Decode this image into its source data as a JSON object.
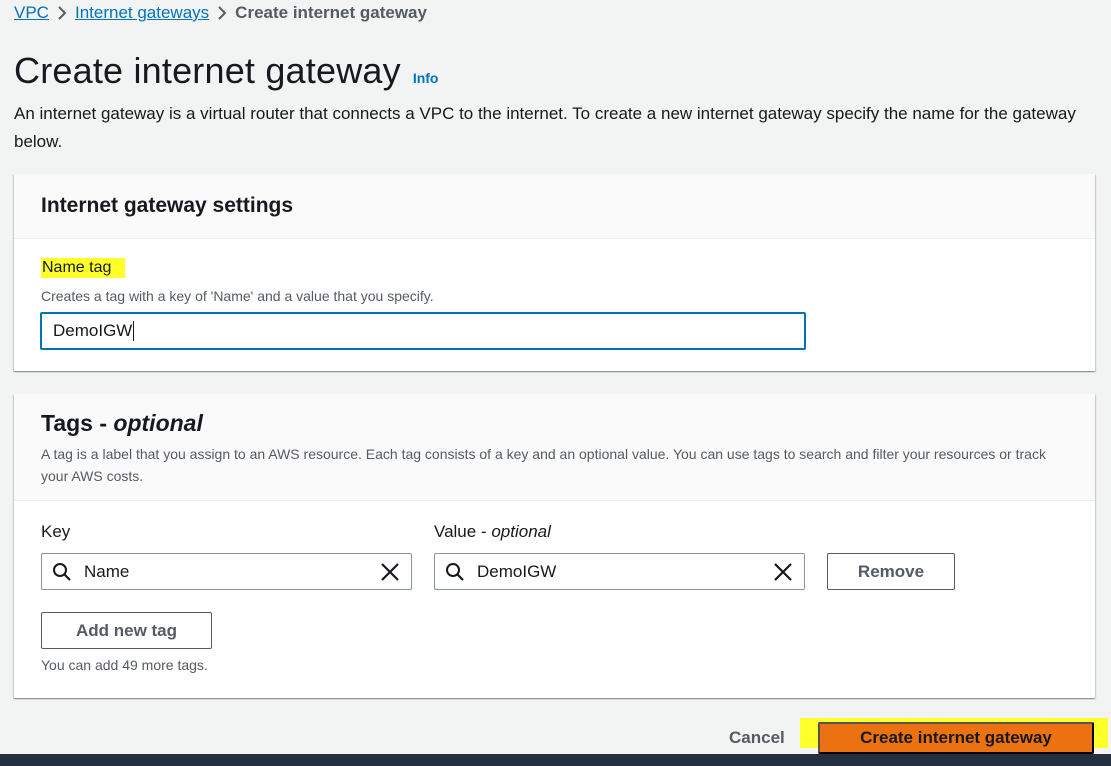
{
  "breadcrumb": {
    "items": [
      "VPC",
      "Internet gateways"
    ],
    "current": "Create internet gateway"
  },
  "header": {
    "title": "Create internet gateway",
    "info": "Info",
    "description": "An internet gateway is a virtual router that connects a VPC to the internet. To create a new internet gateway specify the name for the gateway below."
  },
  "settings": {
    "title": "Internet gateway settings",
    "name_label": "Name tag",
    "name_hint": "Creates a tag with a key of 'Name' and a value that you specify.",
    "name_value": "DemoIGW"
  },
  "tags": {
    "title_prefix": "Tags - ",
    "title_optional": "optional",
    "description": "A tag is a label that you assign to an AWS resource. Each tag consists of a key and an optional value. You can use tags to search and filter your resources or track your AWS costs.",
    "key_label": "Key",
    "value_label_prefix": "Value - ",
    "value_label_optional": "optional",
    "rows": [
      {
        "key": "Name",
        "value": "DemoIGW"
      }
    ],
    "remove_label": "Remove",
    "add_label": "Add new tag",
    "remaining_text": "You can add 49 more tags."
  },
  "footer": {
    "cancel_label": "Cancel",
    "create_label": "Create internet gateway"
  },
  "colors": {
    "link": "#0073bb",
    "primary_button": "#ec7211",
    "highlight": "#ffff2a",
    "bottom_bar": "#232f3e"
  }
}
